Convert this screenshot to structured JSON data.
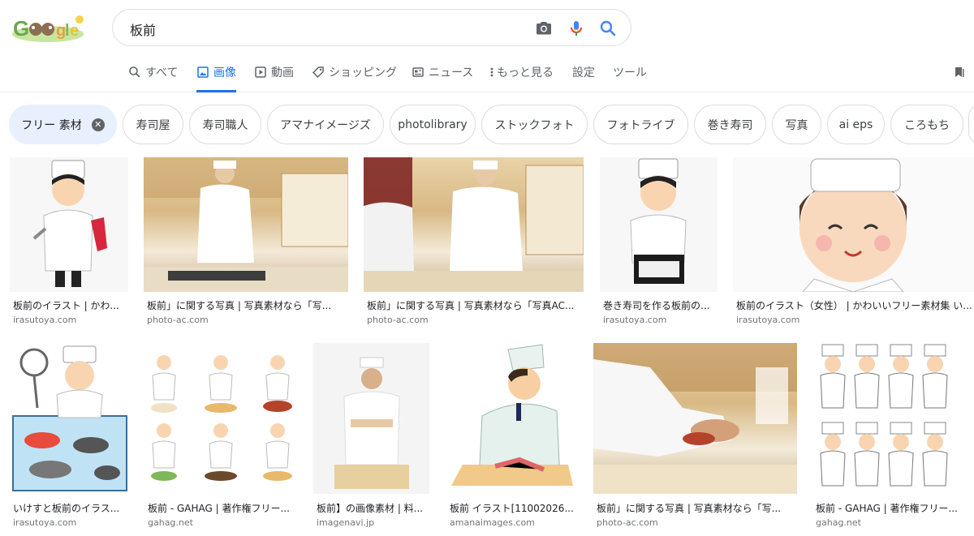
{
  "search": {
    "query": "板前"
  },
  "tabs": [
    {
      "label": "すべて",
      "icon": "search-icon"
    },
    {
      "label": "画像",
      "icon": "image-icon",
      "active": true
    },
    {
      "label": "動画",
      "icon": "video-icon"
    },
    {
      "label": "ショッピング",
      "icon": "tag-icon"
    },
    {
      "label": "ニュース",
      "icon": "news-icon"
    },
    {
      "label": "もっと見る",
      "icon": "more-vert-icon"
    },
    {
      "label": "設定"
    },
    {
      "label": "ツール"
    }
  ],
  "chips": [
    {
      "label": "フリー 素材",
      "selected": true
    },
    {
      "label": "寿司屋"
    },
    {
      "label": "寿司職人"
    },
    {
      "label": "アマナイメージズ"
    },
    {
      "label": "photolibrary"
    },
    {
      "label": "ストックフォト"
    },
    {
      "label": "フォトライブ"
    },
    {
      "label": "巻き寿司"
    },
    {
      "label": "写真"
    },
    {
      "label": "ai eps"
    },
    {
      "label": "ころもち"
    }
  ],
  "results": [
    {
      "caption": "板前のイラスト | かわ...",
      "source": "irasutoya.com"
    },
    {
      "caption": "板前」に関する写真 | 写真素材なら「写...",
      "source": "photo-ac.com"
    },
    {
      "caption": "板前」に関する写真 | 写真素材なら「写真AC...",
      "source": "photo-ac.com"
    },
    {
      "caption": "巻き寿司を作る板前の...",
      "source": "irasutoya.com"
    },
    {
      "caption": "板前のイラスト（女性） | かわいいフリー素材集 い...",
      "source": "irasutoya.com"
    },
    {
      "caption": "いけすと板前のイラス...",
      "source": "irasutoya.com"
    },
    {
      "caption": "板前 - GAHAG | 著作権フリー...",
      "source": "gahag.net"
    },
    {
      "caption": "板前】の画像素材 | 料...",
      "source": "imagenavi.jp"
    },
    {
      "caption": "板前 イラスト[11002026...",
      "source": "amanaimages.com"
    },
    {
      "caption": "板前」に関する写真 | 写真素材なら「写...",
      "source": "photo-ac.com"
    },
    {
      "caption": "板前 - GAHAG | 著作権フリー...",
      "source": "gahag.net"
    }
  ],
  "colors": {
    "accent": "#1a73e8",
    "chip_selected_bg": "#e8f0fe",
    "mic_red": "#ea4335"
  }
}
